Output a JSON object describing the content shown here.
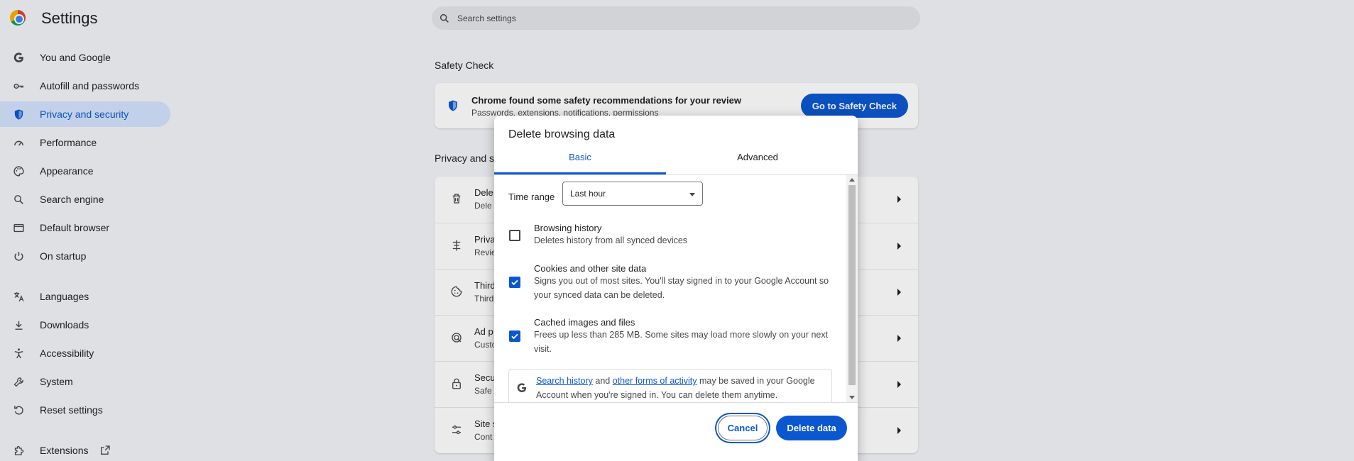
{
  "app": {
    "title": "Settings"
  },
  "search": {
    "placeholder": "Search settings"
  },
  "sidebar": {
    "items": [
      {
        "label": "You and Google",
        "icon": "google-icon"
      },
      {
        "label": "Autofill and passwords",
        "icon": "key-icon"
      },
      {
        "label": "Privacy and security",
        "icon": "shield-icon",
        "active": true
      },
      {
        "label": "Performance",
        "icon": "speedometer-icon"
      },
      {
        "label": "Appearance",
        "icon": "palette-icon"
      },
      {
        "label": "Search engine",
        "icon": "search-icon"
      },
      {
        "label": "Default browser",
        "icon": "browser-icon"
      },
      {
        "label": "On startup",
        "icon": "power-icon"
      },
      {
        "label": "Languages",
        "icon": "translate-icon"
      },
      {
        "label": "Downloads",
        "icon": "download-icon"
      },
      {
        "label": "Accessibility",
        "icon": "accessibility-icon"
      },
      {
        "label": "System",
        "icon": "wrench-icon"
      },
      {
        "label": "Reset settings",
        "icon": "reset-icon"
      },
      {
        "label": "Extensions",
        "icon": "puzzle-icon",
        "external": true
      }
    ]
  },
  "safety_check": {
    "heading": "Safety Check",
    "title": "Chrome found some safety recommendations for your review",
    "subtitle": "Passwords, extensions, notifications, permissions",
    "button": "Go to Safety Check"
  },
  "privacy": {
    "heading": "Privacy and s",
    "rows": [
      {
        "title": "Dele",
        "sub": "Dele",
        "icon": "trash-icon"
      },
      {
        "title": "Priva",
        "sub": "Revie",
        "icon": "tune-icon"
      },
      {
        "title": "Third",
        "sub": "Third",
        "icon": "cookie-icon"
      },
      {
        "title": "Ad p",
        "sub": "Custo",
        "icon": "ad-icon"
      },
      {
        "title": "Secu",
        "sub": "Safe",
        "icon": "lock-icon"
      },
      {
        "title": "Site s",
        "sub": "Cont",
        "icon": "sliders-icon"
      }
    ]
  },
  "dialog": {
    "title": "Delete browsing data",
    "tabs": {
      "basic": "Basic",
      "advanced": "Advanced"
    },
    "time_range": {
      "label": "Time range",
      "value": "Last hour"
    },
    "options": [
      {
        "title": "Browsing history",
        "desc": "Deletes history from all synced devices",
        "checked": false
      },
      {
        "title": "Cookies and other site data",
        "desc": "Signs you out of most sites. You'll stay signed in to your Google Account so your synced data can be deleted.",
        "checked": true
      },
      {
        "title": "Cached images and files",
        "desc": "Frees up less than 285 MB. Some sites may load more slowly on your next visit.",
        "checked": true
      }
    ],
    "info": {
      "link1": "Search history",
      "and": "and",
      "link2": "other forms of activity",
      "rest": "may be saved in your Google Account when you're signed in. You can delete them anytime."
    },
    "buttons": {
      "cancel": "Cancel",
      "delete": "Delete data"
    }
  },
  "colors": {
    "accent": "#0b57d0",
    "active_nav_bg": "#d3e3fd",
    "background": "#f1f3f7"
  }
}
